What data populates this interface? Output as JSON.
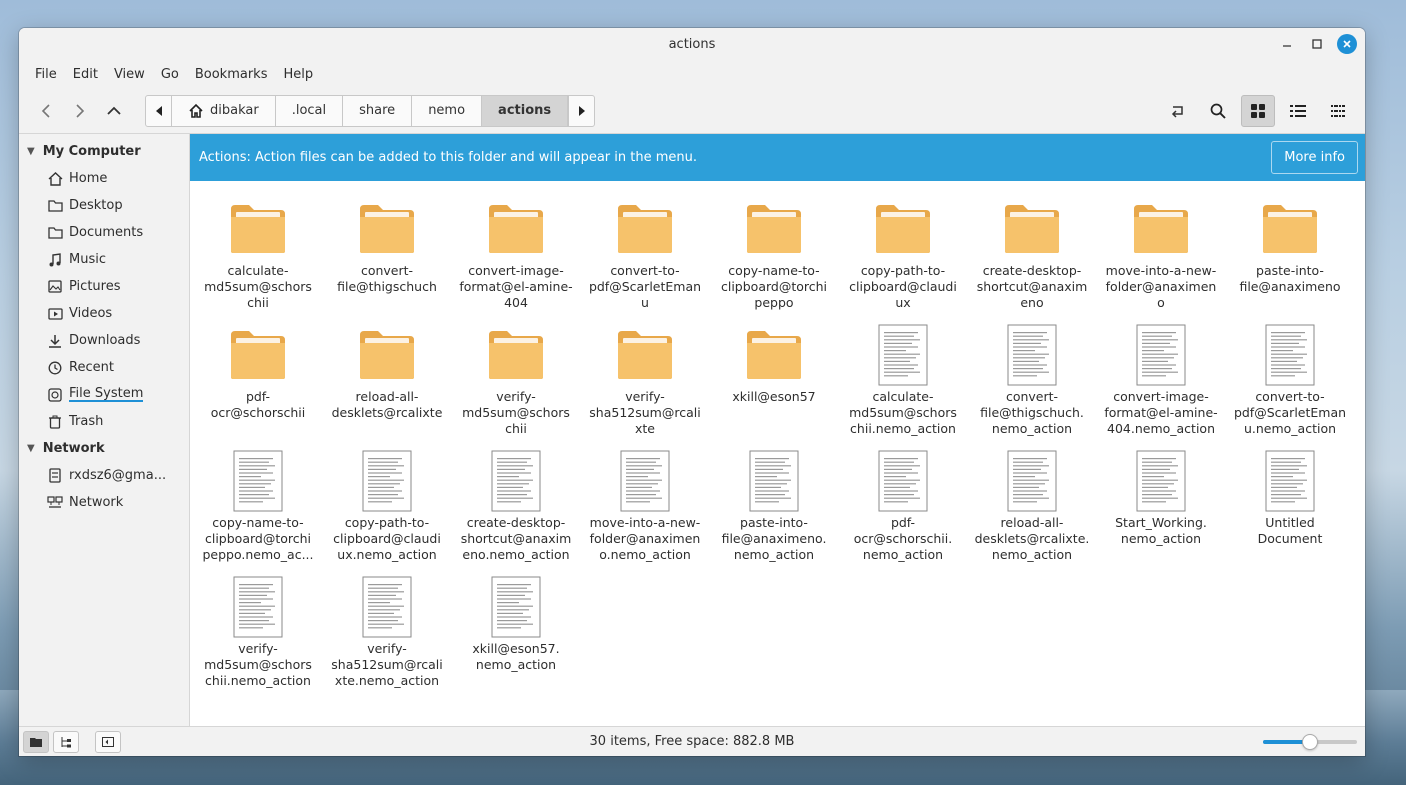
{
  "window": {
    "title": "actions"
  },
  "menu": [
    "File",
    "Edit",
    "View",
    "Go",
    "Bookmarks",
    "Help"
  ],
  "pathbar": {
    "crumbs": [
      {
        "label": "dibakar",
        "icon": "home-icon"
      },
      {
        "label": ".local"
      },
      {
        "label": "share"
      },
      {
        "label": "nemo"
      },
      {
        "label": "actions",
        "active": true
      }
    ]
  },
  "sidebar": {
    "sections": [
      {
        "header": "My Computer",
        "items": [
          {
            "label": "Home",
            "icon": "home-icon"
          },
          {
            "label": "Desktop",
            "icon": "desktop-icon"
          },
          {
            "label": "Documents",
            "icon": "documents-icon"
          },
          {
            "label": "Music",
            "icon": "music-icon"
          },
          {
            "label": "Pictures",
            "icon": "pictures-icon"
          },
          {
            "label": "Videos",
            "icon": "videos-icon"
          },
          {
            "label": "Downloads",
            "icon": "downloads-icon"
          },
          {
            "label": "Recent",
            "icon": "recent-icon"
          },
          {
            "label": "File System",
            "icon": "filesystem-icon",
            "underlined": true
          },
          {
            "label": "Trash",
            "icon": "trash-icon"
          }
        ]
      },
      {
        "header": "Network",
        "items": [
          {
            "label": "rxdsz6@gma...",
            "icon": "server-icon"
          },
          {
            "label": "Network",
            "icon": "network-icon"
          }
        ]
      }
    ]
  },
  "infobar": {
    "message": "Actions: Action files can be added to this folder and will appear in the menu.",
    "button": "More info"
  },
  "files": [
    {
      "name": "calculate-md5sum@schorschii",
      "lines": [
        "calculate-",
        "md5sum@schors",
        "chii"
      ],
      "type": "folder"
    },
    {
      "name": "convert-file@thigschuch",
      "lines": [
        "convert-",
        "file@thigschuch"
      ],
      "type": "folder"
    },
    {
      "name": "convert-image-format@el-amine-404",
      "lines": [
        "convert-image-",
        "format@el-amine-",
        "404"
      ],
      "type": "folder"
    },
    {
      "name": "convert-to-pdf@ScarletEmanu",
      "lines": [
        "convert-to-",
        "pdf@ScarletEman",
        "u"
      ],
      "type": "folder"
    },
    {
      "name": "copy-name-to-clipboard@torchipeppo",
      "lines": [
        "copy-name-to-",
        "clipboard@torchi",
        "peppo"
      ],
      "type": "folder"
    },
    {
      "name": "copy-path-to-clipboard@claudiux",
      "lines": [
        "copy-path-to-",
        "clipboard@claudi",
        "ux"
      ],
      "type": "folder"
    },
    {
      "name": "create-desktop-shortcut@anaximeno",
      "lines": [
        "create-desktop-",
        "shortcut@anaxim",
        "eno"
      ],
      "type": "folder"
    },
    {
      "name": "move-into-a-new-folder@anaximeno",
      "lines": [
        "move-into-a-new-",
        "folder@anaximen",
        "o"
      ],
      "type": "folder"
    },
    {
      "name": "paste-into-file@anaximeno",
      "lines": [
        "paste-into-",
        "file@anaximeno"
      ],
      "type": "folder"
    },
    {
      "name": "pdf-ocr@schorschii",
      "lines": [
        "pdf-",
        "ocr@schorschii"
      ],
      "type": "folder"
    },
    {
      "name": "reload-all-desklets@rcalixte",
      "lines": [
        "reload-all-",
        "desklets@rcalixte"
      ],
      "type": "folder"
    },
    {
      "name": "verify-md5sum@schorschii",
      "lines": [
        "verify-",
        "md5sum@schors",
        "chii"
      ],
      "type": "folder"
    },
    {
      "name": "verify-sha512sum@rcalixte",
      "lines": [
        "verify-",
        "sha512sum@rcali",
        "xte"
      ],
      "type": "folder"
    },
    {
      "name": "xkill@eson57",
      "lines": [
        "xkill@eson57"
      ],
      "type": "folder"
    },
    {
      "name": "calculate-md5sum@schorschii.nemo_action",
      "lines": [
        "calculate-",
        "md5sum@schors",
        "chii.nemo_action"
      ],
      "type": "doc"
    },
    {
      "name": "convert-file@thigschuch.nemo_action",
      "lines": [
        "convert-",
        "file@thigschuch.",
        "nemo_action"
      ],
      "type": "doc"
    },
    {
      "name": "convert-image-format@el-amine-404.nemo_action",
      "lines": [
        "convert-image-",
        "format@el-amine-",
        "404.nemo_action"
      ],
      "type": "doc"
    },
    {
      "name": "convert-to-pdf@ScarletEmanu.nemo_action",
      "lines": [
        "convert-to-",
        "pdf@ScarletEman",
        "u.nemo_action"
      ],
      "type": "doc"
    },
    {
      "name": "copy-name-to-clipboard@torchipeppo.nemo_ac...",
      "lines": [
        "copy-name-to-",
        "clipboard@torchi",
        "peppo.nemo_ac..."
      ],
      "type": "doc"
    },
    {
      "name": "copy-path-to-clipboard@claudiux.nemo_action",
      "lines": [
        "copy-path-to-",
        "clipboard@claudi",
        "ux.nemo_action"
      ],
      "type": "doc"
    },
    {
      "name": "create-desktop-shortcut@anaximeno.nemo_action",
      "lines": [
        "create-desktop-",
        "shortcut@anaxim",
        "eno.nemo_action"
      ],
      "type": "doc"
    },
    {
      "name": "move-into-a-new-folder@anaximeno.nemo_action",
      "lines": [
        "move-into-a-new-",
        "folder@anaximen",
        "o.nemo_action"
      ],
      "type": "doc"
    },
    {
      "name": "paste-into-file@anaximeno.nemo_action",
      "lines": [
        "paste-into-",
        "file@anaximeno.",
        "nemo_action"
      ],
      "type": "doc"
    },
    {
      "name": "pdf-ocr@schorschii.nemo_action",
      "lines": [
        "pdf-",
        "ocr@schorschii.",
        "nemo_action"
      ],
      "type": "doc"
    },
    {
      "name": "reload-all-desklets@rcalixte.nemo_action",
      "lines": [
        "reload-all-",
        "desklets@rcalixte.",
        "nemo_action"
      ],
      "type": "doc"
    },
    {
      "name": "Start_Working.nemo_action",
      "lines": [
        "Start_Working.",
        "nemo_action"
      ],
      "type": "doc"
    },
    {
      "name": "Untitled Document",
      "lines": [
        "Untitled",
        "Document"
      ],
      "type": "doc"
    },
    {
      "name": "verify-md5sum@schorschii.nemo_action",
      "lines": [
        "verify-",
        "md5sum@schors",
        "chii.nemo_action"
      ],
      "type": "doc"
    },
    {
      "name": "verify-sha512sum@rcalixte.nemo_action",
      "lines": [
        "verify-",
        "sha512sum@rcali",
        "xte.nemo_action"
      ],
      "type": "doc"
    },
    {
      "name": "xkill@eson57.nemo_action",
      "lines": [
        "xkill@eson57.",
        "nemo_action"
      ],
      "type": "doc"
    }
  ],
  "status": {
    "text": "30 items, Free space: 882.8 MB"
  },
  "zoom": {
    "level": 0.5
  },
  "colors": {
    "accent": "#1e90d6",
    "infobar": "#2d9fd9",
    "folder": "#f6c26b"
  }
}
